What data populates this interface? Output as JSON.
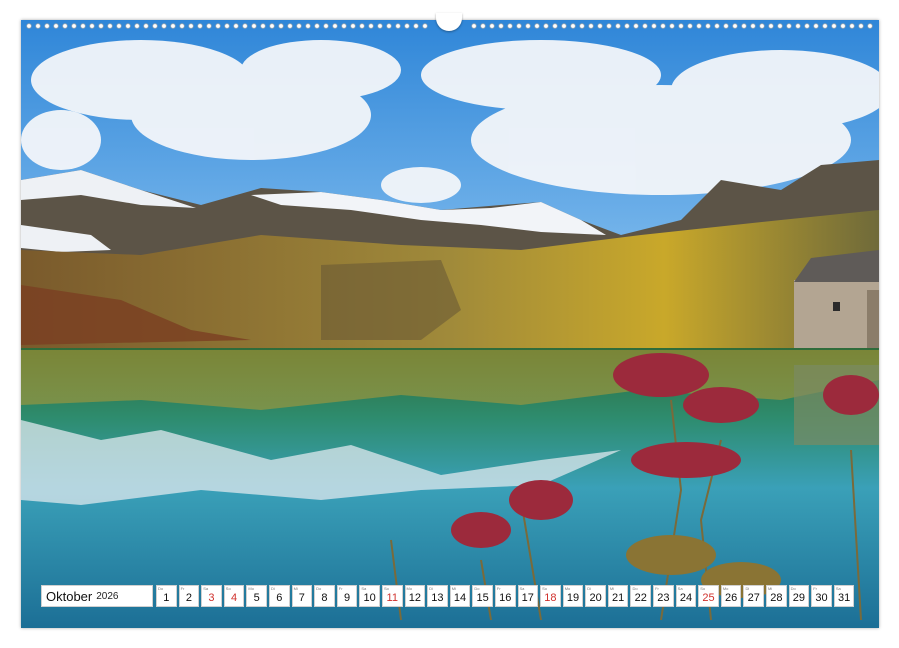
{
  "calendar": {
    "month": "Oktober",
    "year": "2026",
    "accent_color": "#d0312d",
    "days": [
      {
        "wd": "Do",
        "num": "1",
        "holiday": false
      },
      {
        "wd": "Fr",
        "num": "2",
        "holiday": false
      },
      {
        "wd": "Sa",
        "num": "3",
        "holiday": true
      },
      {
        "wd": "So",
        "num": "4",
        "holiday": true
      },
      {
        "wd": "Mo",
        "num": "5",
        "holiday": false
      },
      {
        "wd": "Di",
        "num": "6",
        "holiday": false
      },
      {
        "wd": "Mi",
        "num": "7",
        "holiday": false
      },
      {
        "wd": "Do",
        "num": "8",
        "holiday": false
      },
      {
        "wd": "Fr",
        "num": "9",
        "holiday": false
      },
      {
        "wd": "Sa",
        "num": "10",
        "holiday": false
      },
      {
        "wd": "So",
        "num": "11",
        "holiday": true
      },
      {
        "wd": "Mo",
        "num": "12",
        "holiday": false
      },
      {
        "wd": "Di",
        "num": "13",
        "holiday": false
      },
      {
        "wd": "Mi",
        "num": "14",
        "holiday": false
      },
      {
        "wd": "Do",
        "num": "15",
        "holiday": false
      },
      {
        "wd": "Fr",
        "num": "16",
        "holiday": false
      },
      {
        "wd": "Sa",
        "num": "17",
        "holiday": false
      },
      {
        "wd": "So",
        "num": "18",
        "holiday": true
      },
      {
        "wd": "Mo",
        "num": "19",
        "holiday": false
      },
      {
        "wd": "Di",
        "num": "20",
        "holiday": false
      },
      {
        "wd": "Mi",
        "num": "21",
        "holiday": false
      },
      {
        "wd": "Do",
        "num": "22",
        "holiday": false
      },
      {
        "wd": "Fr",
        "num": "23",
        "holiday": false
      },
      {
        "wd": "Sa",
        "num": "24",
        "holiday": false
      },
      {
        "wd": "So",
        "num": "25",
        "holiday": true
      },
      {
        "wd": "Mo",
        "num": "26",
        "holiday": false
      },
      {
        "wd": "Di",
        "num": "27",
        "holiday": false
      },
      {
        "wd": "Mi",
        "num": "28",
        "holiday": false
      },
      {
        "wd": "Do",
        "num": "29",
        "holiday": false
      },
      {
        "wd": "Fr",
        "num": "30",
        "holiday": false
      },
      {
        "wd": "Sa",
        "num": "31",
        "holiday": false
      }
    ]
  }
}
